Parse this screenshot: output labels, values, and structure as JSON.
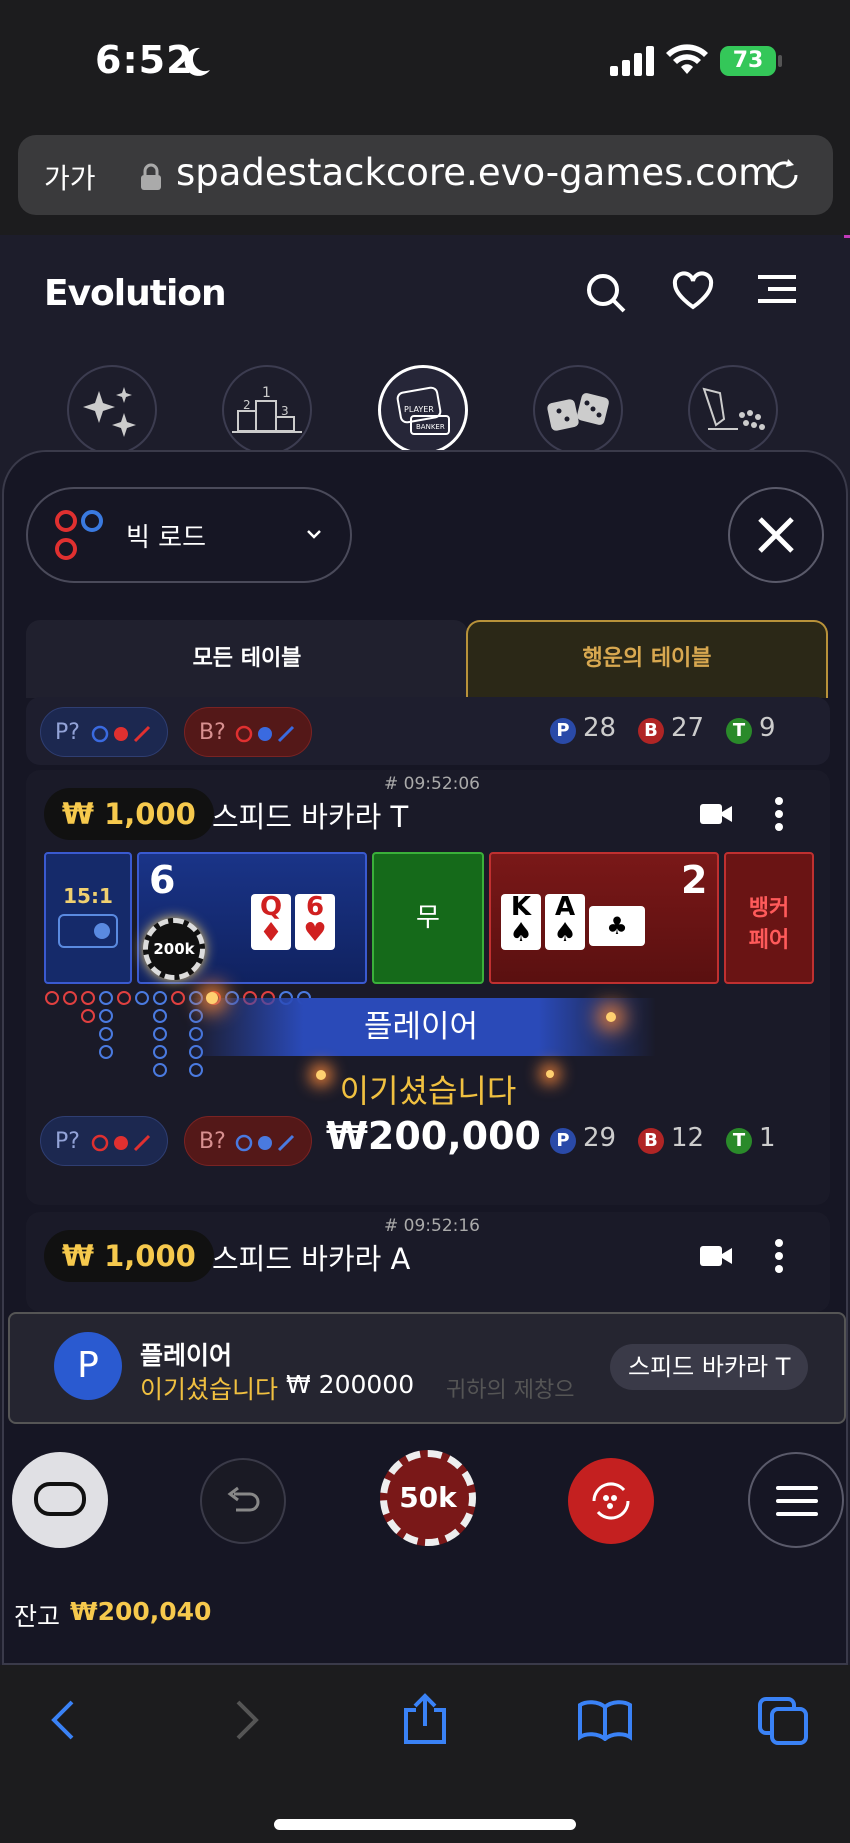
{
  "status": {
    "time": "6:52",
    "battery": "73"
  },
  "browser": {
    "aa_label": "가가",
    "url": "spadestackcore.evo-games.com"
  },
  "header": {
    "logo": "Evolution"
  },
  "categories": [
    "sparkles-icon",
    "podium-icon",
    "baccarat-icon",
    "dice-icon",
    "wheel-icon"
  ],
  "road_select": {
    "label": "빅 로드"
  },
  "tabs": {
    "all": "모든 테이블",
    "lucky": "행운의 테이블"
  },
  "top_row": {
    "p_pill": "P?",
    "b_pill": "B?",
    "p_count": "28",
    "b_count": "27",
    "t_count": "9"
  },
  "table1": {
    "timestamp": "# 09:52:06",
    "price": "₩ 1,000",
    "name": "스피드 바카라 T",
    "side_odds": "15:1",
    "player_score": "6",
    "chip": "200k",
    "player_cards": [
      "Q",
      "6"
    ],
    "tie_label": "무",
    "banker_cards": [
      "K",
      "A"
    ],
    "banker_score": "2",
    "banker_pair": "뱅커\n페어",
    "result_label": "플레이어",
    "win_text": "이기셨습니다",
    "win_amount": "₩200,000",
    "p_pill": "P?",
    "b_pill": "B?",
    "p_count": "29",
    "b_count": "12",
    "t_count": "1"
  },
  "table2": {
    "timestamp": "# 09:52:16",
    "price": "₩ 1,000",
    "name": "스피드 바카라 A"
  },
  "toast": {
    "avatar": "P",
    "title": "플레이어",
    "won_label": "이기셨습니다",
    "amount": "₩ 200000",
    "table": "스피드 바카라 T",
    "bg_text": "귀하의 제창으"
  },
  "controls": {
    "chip_value": "50k"
  },
  "balance": {
    "label": "잔고",
    "amount": "₩200,040"
  },
  "colors": {
    "gold": "#f6c94d",
    "player": "#1d3a9a",
    "banker": "#8a1c1c",
    "tie": "#1f7a1f"
  }
}
